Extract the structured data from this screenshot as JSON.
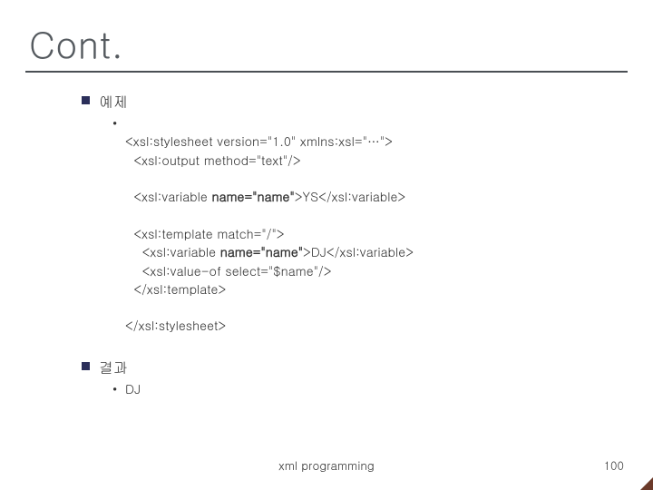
{
  "title": "Cont.",
  "sections": {
    "example": {
      "label": "예제",
      "code": {
        "l1": "<xsl:stylesheet version=\"1.0\" xmlns:xsl=\"…\">",
        "l2": "  <xsl:output method=\"text\"/>",
        "l3a": "  <xsl:variable ",
        "l3b": "name=\"name\"",
        "l3c": ">YS</xsl:variable>",
        "l4": "  <xsl:template match=\"/\">",
        "l5a": "    <xsl:variable ",
        "l5b": "name=\"name\"",
        "l5c": ">DJ</xsl:variable>",
        "l6": "    <xsl:value-of select=\"$name\"/>",
        "l7": "  </xsl:template>",
        "l8": "</xsl:stylesheet>"
      }
    },
    "result": {
      "label": "결과",
      "value": "DJ"
    }
  },
  "footer": {
    "center": "xml programming",
    "page": "100"
  },
  "bullet_dot": "•"
}
